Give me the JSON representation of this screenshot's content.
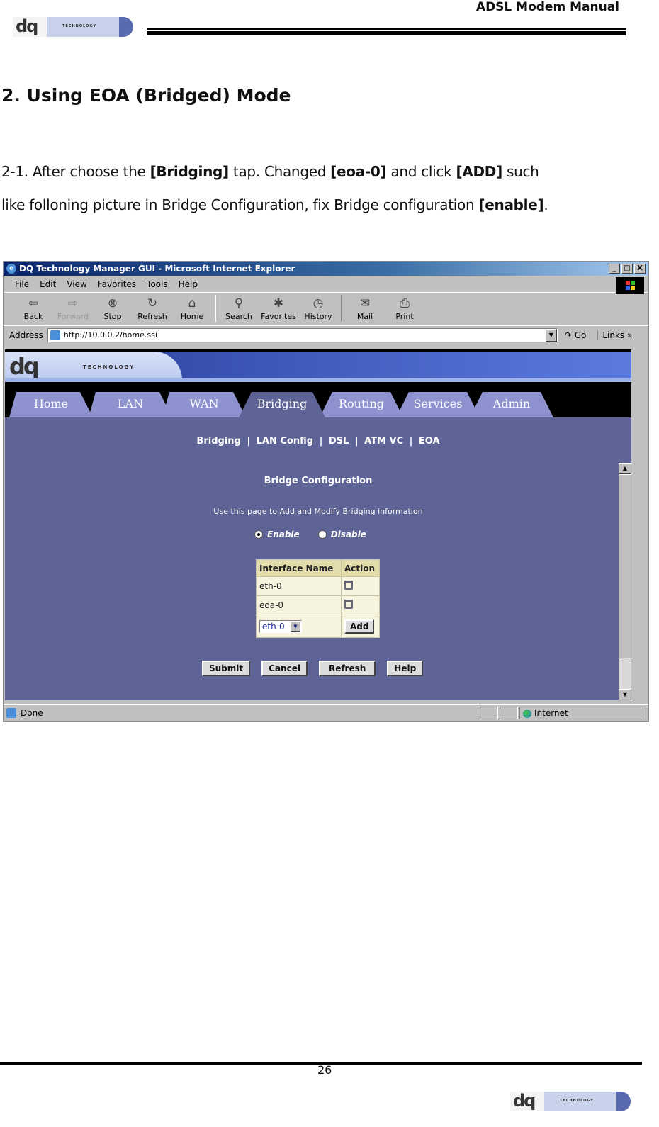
{
  "header": {
    "title": "ADSL Modem Manual",
    "logo_text": "dq",
    "logo_sub": "TECHNOLOGY"
  },
  "section": {
    "heading": "2. Using EOA (Bridged) Mode",
    "para_line1": {
      "t1": "2-1. After choose the ",
      "b1": "[Bridging]",
      "t2": " tap. Changed ",
      "b2": "[eoa-0]",
      "t3": " and click ",
      "b3": "[ADD]",
      "t4": " such"
    },
    "para_line2": {
      "t1": "like folloning picture in Bridge Configuration, fix Bridge configuration ",
      "b1": "[enable]",
      "t2": "."
    }
  },
  "browser": {
    "window_title": "DQ Technology Manager GUI - Microsoft Internet Explorer",
    "window_buttons": {
      "minimize": "_",
      "maximize": "□",
      "close": "X"
    },
    "menu": [
      "File",
      "Edit",
      "View",
      "Favorites",
      "Tools",
      "Help"
    ],
    "toolbar": [
      {
        "label": "Back",
        "icon": "⇦",
        "disabled": false
      },
      {
        "label": "Forward",
        "icon": "⇨",
        "disabled": true
      },
      {
        "label": "Stop",
        "icon": "⊗",
        "disabled": false
      },
      {
        "label": "Refresh",
        "icon": "↻",
        "disabled": false
      },
      {
        "label": "Home",
        "icon": "⌂",
        "disabled": false
      },
      {
        "label": "Search",
        "icon": "⚲",
        "disabled": false
      },
      {
        "label": "Favorites",
        "icon": "✱",
        "disabled": false
      },
      {
        "label": "History",
        "icon": "◷",
        "disabled": false
      },
      {
        "label": "Mail",
        "icon": "✉",
        "disabled": false
      },
      {
        "label": "Print",
        "icon": "⎙",
        "disabled": false
      }
    ],
    "address_label": "Address",
    "address_value": "http://10.0.0.2/home.ssi",
    "go_label": "Go",
    "links_label": "Links »",
    "status_text": "Done",
    "zone_text": "Internet"
  },
  "app": {
    "logo_text": "dq",
    "logo_sub": "TECHNOLOGY",
    "tabs": [
      "Home",
      "LAN",
      "WAN",
      "Bridging",
      "Routing",
      "Services",
      "Admin"
    ],
    "active_tab": "Bridging",
    "subnav": [
      "Bridging",
      "LAN Config",
      "DSL",
      "ATM VC",
      "EOA"
    ],
    "subnav_sep": "|",
    "page_title": "Bridge Configuration",
    "page_desc": "Use this page to Add and Modify Bridging information",
    "radio_enable": "Enable",
    "radio_disable": "Disable",
    "radio_selected": "Enable",
    "table": {
      "headers": [
        "Interface Name",
        "Action"
      ],
      "rows": [
        {
          "name": "eth-0",
          "action": "delete"
        },
        {
          "name": "eoa-0",
          "action": "delete"
        }
      ],
      "select_value": "eth-0",
      "add_label": "Add"
    },
    "buttons": [
      "Submit",
      "Cancel",
      "Refresh",
      "Help"
    ]
  },
  "footer": {
    "page_number": "26"
  }
}
